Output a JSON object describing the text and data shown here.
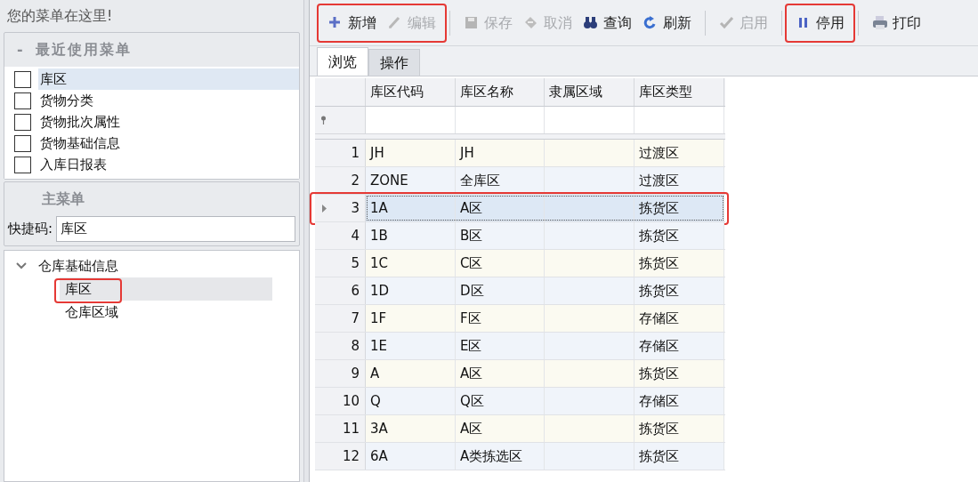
{
  "sidebar": {
    "title": "您的菜单在这里!",
    "recent": {
      "collapse_glyph": "-",
      "title": "最近使用菜单",
      "items": [
        {
          "label": "库区",
          "checked": false,
          "selected": true
        },
        {
          "label": "货物分类",
          "checked": false,
          "selected": false
        },
        {
          "label": "货物批次属性",
          "checked": false,
          "selected": false
        },
        {
          "label": "货物基础信息",
          "checked": false,
          "selected": false
        },
        {
          "label": "入库日报表",
          "checked": false,
          "selected": false
        }
      ]
    },
    "main_menu": {
      "title": "主菜单",
      "shortcut_label": "快捷码:",
      "shortcut_value": "库区"
    },
    "tree": [
      {
        "label": "仓库基础信息",
        "expanded": true,
        "selected": false,
        "highlighted": false,
        "children": [
          {
            "label": "库区",
            "selected": true,
            "highlighted": true
          },
          {
            "label": "仓库区域",
            "selected": false,
            "highlighted": false
          }
        ]
      }
    ]
  },
  "toolbar": {
    "groups": [
      {
        "highlighted": true,
        "buttons": [
          {
            "kind": "add",
            "label": "新增",
            "disabled": false
          },
          {
            "kind": "edit",
            "label": "编辑",
            "disabled": true
          }
        ]
      },
      {
        "highlighted": false,
        "buttons": [
          {
            "kind": "save",
            "label": "保存",
            "disabled": true
          },
          {
            "kind": "cancel",
            "label": "取消",
            "disabled": true
          },
          {
            "kind": "query",
            "label": "查询",
            "disabled": false
          },
          {
            "kind": "refresh",
            "label": "刷新",
            "disabled": false
          }
        ]
      },
      {
        "highlighted": false,
        "buttons": [
          {
            "kind": "enable",
            "label": "启用",
            "disabled": true
          }
        ]
      },
      {
        "highlighted": true,
        "buttons": [
          {
            "kind": "disable",
            "label": "停用",
            "disabled": false
          }
        ]
      },
      {
        "highlighted": false,
        "buttons": [
          {
            "kind": "print",
            "label": "打印",
            "disabled": false
          }
        ]
      }
    ]
  },
  "tabs": [
    {
      "label": "浏览",
      "selected": true
    },
    {
      "label": "操作",
      "selected": false
    }
  ],
  "table": {
    "columns": [
      "库区代码",
      "库区名称",
      "隶属区域",
      "库区类型"
    ],
    "rows": [
      {
        "number": "1",
        "cells": [
          "JH",
          "JH",
          "",
          "过渡区"
        ],
        "selected": false,
        "highlighted": false
      },
      {
        "number": "2",
        "cells": [
          "ZONE",
          "全库区",
          "",
          "过渡区"
        ],
        "selected": false,
        "highlighted": false
      },
      {
        "number": "3",
        "cells": [
          "1A",
          "A区",
          "",
          "拣货区"
        ],
        "selected": true,
        "highlighted": true
      },
      {
        "number": "4",
        "cells": [
          "1B",
          "B区",
          "",
          "拣货区"
        ],
        "selected": false,
        "highlighted": false
      },
      {
        "number": "5",
        "cells": [
          "1C",
          "C区",
          "",
          "拣货区"
        ],
        "selected": false,
        "highlighted": false
      },
      {
        "number": "6",
        "cells": [
          "1D",
          "D区",
          "",
          "拣货区"
        ],
        "selected": false,
        "highlighted": false
      },
      {
        "number": "7",
        "cells": [
          "1F",
          "F区",
          "",
          "存储区"
        ],
        "selected": false,
        "highlighted": false
      },
      {
        "number": "8",
        "cells": [
          "1E",
          "E区",
          "",
          "存储区"
        ],
        "selected": false,
        "highlighted": false
      },
      {
        "number": "9",
        "cells": [
          "A",
          "A区",
          "",
          "拣货区"
        ],
        "selected": false,
        "highlighted": false
      },
      {
        "number": "10",
        "cells": [
          "Q",
          "Q区",
          "",
          "存储区"
        ],
        "selected": false,
        "highlighted": false
      },
      {
        "number": "11",
        "cells": [
          "3A",
          "A区",
          "",
          "拣货区"
        ],
        "selected": false,
        "highlighted": false
      },
      {
        "number": "12",
        "cells": [
          "6A",
          "A类拣选区",
          "",
          "拣货区"
        ],
        "selected": false,
        "highlighted": false
      }
    ]
  }
}
